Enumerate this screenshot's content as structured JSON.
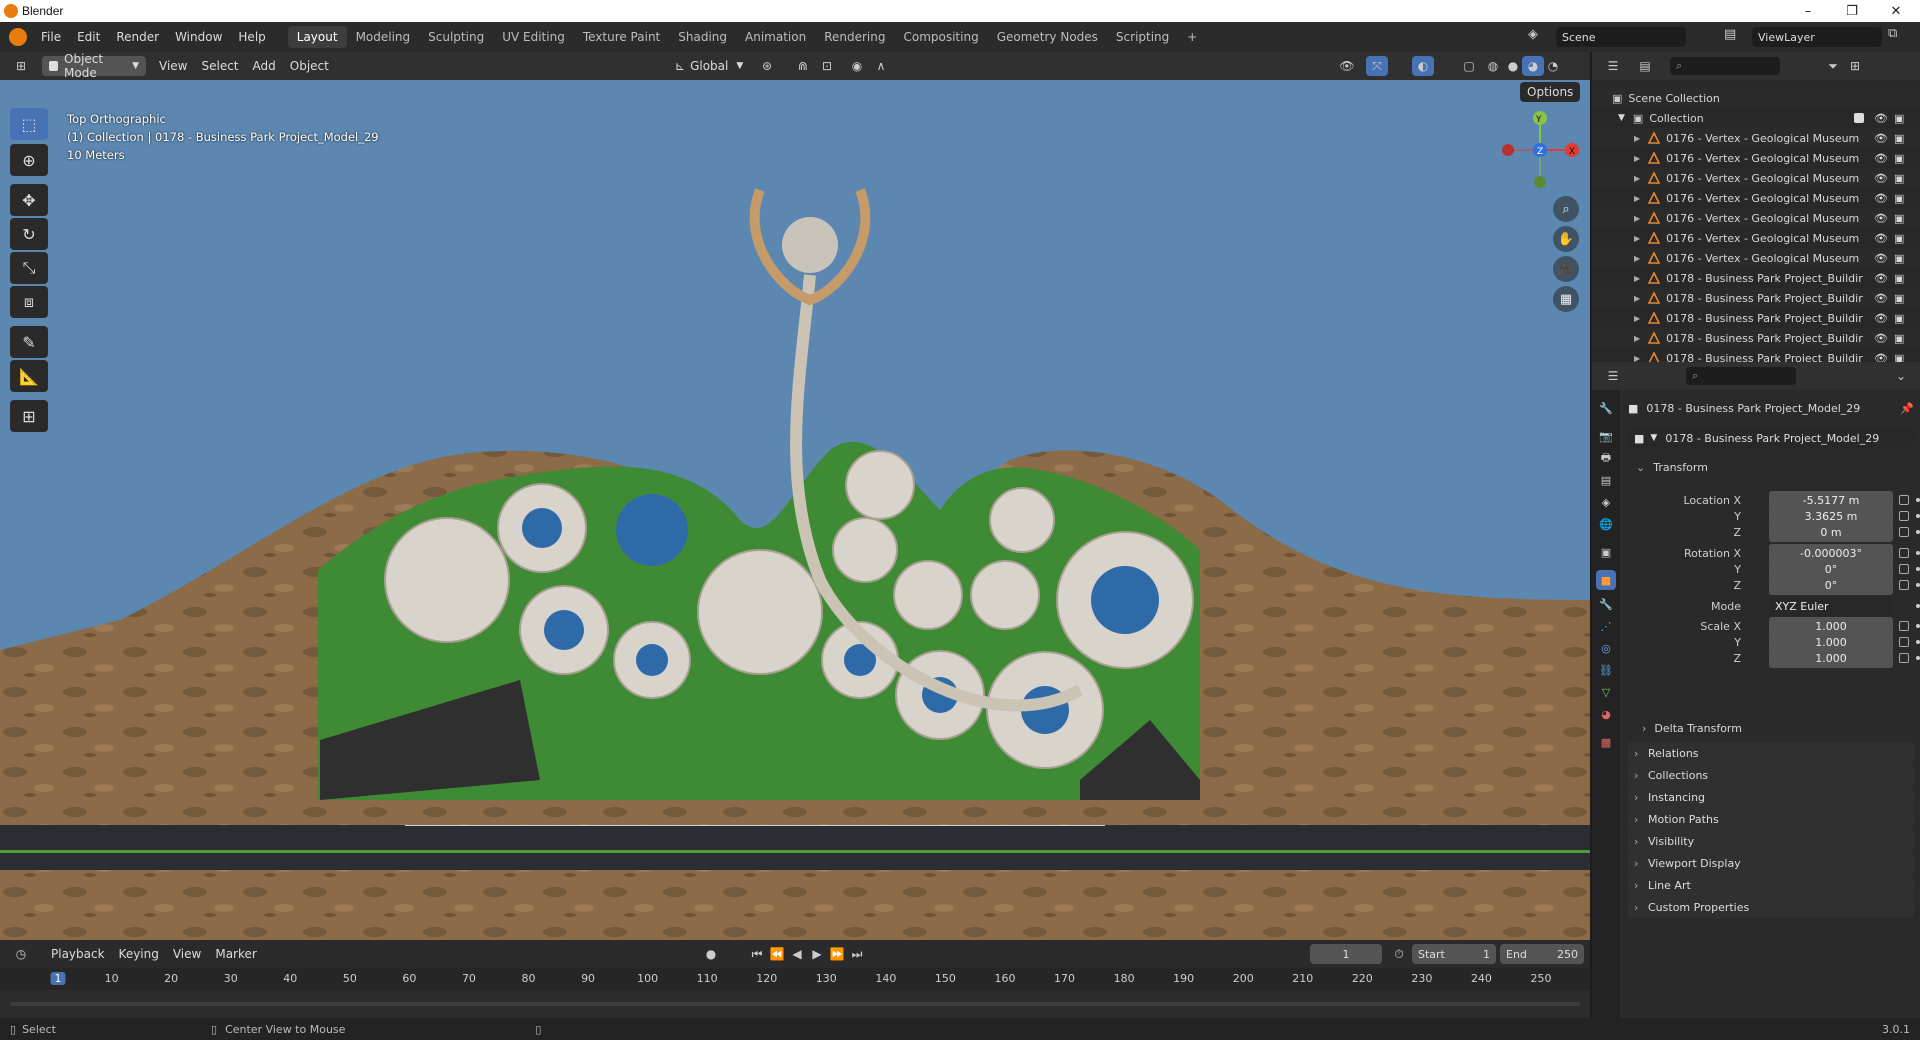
{
  "window": {
    "title": "Blender",
    "controls": [
      "–",
      "❐",
      "✕"
    ]
  },
  "menu": [
    "File",
    "Edit",
    "Render",
    "Window",
    "Help"
  ],
  "workspaces": [
    "Layout",
    "Modeling",
    "Sculpting",
    "UV Editing",
    "Texture Paint",
    "Shading",
    "Animation",
    "Rendering",
    "Compositing",
    "Geometry Nodes",
    "Scripting",
    "+"
  ],
  "active_workspace": "Layout",
  "scene": {
    "name": "Scene",
    "view_layer": "ViewLayer"
  },
  "viewport_header": {
    "mode": "Object Mode",
    "menus": [
      "View",
      "Select",
      "Add",
      "Object"
    ],
    "orientation": "Global",
    "options": "Options"
  },
  "viewport": {
    "view_name": "Top Orthographic",
    "collection_line": "(1) Collection | 0178 - Business Park Project_Model_29",
    "scale": "10 Meters",
    "gizmo": {
      "x": "X",
      "y": "Y",
      "z": "Z"
    }
  },
  "outliner": {
    "root": "Scene Collection",
    "collection": "Collection",
    "items": [
      "0176 - Vertex - Geological Museum",
      "0176 - Vertex - Geological Museum",
      "0176 - Vertex - Geological Museum",
      "0176 - Vertex - Geological Museum",
      "0176 - Vertex - Geological Museum",
      "0176 - Vertex - Geological Museum",
      "0176 - Vertex - Geological Museum",
      "0178 - Business Park Project_Buildir",
      "0178 - Business Park Project_Buildir",
      "0178 - Business Park Project_Buildir",
      "0178 - Business Park Project_Buildir",
      "0178 - Business Park Project_Buildir"
    ]
  },
  "properties": {
    "object_name": "0178 - Business Park Project_Model_29",
    "datablock": "0178 - Business Park Project_Model_29",
    "transform_label": "Transform",
    "rows": [
      {
        "label": "Location X",
        "value": "-5.5177 m"
      },
      {
        "label": "Y",
        "value": "3.3625 m"
      },
      {
        "label": "Z",
        "value": "0 m"
      },
      {
        "label": "Rotation X",
        "value": "-0.000003°"
      },
      {
        "label": "Y",
        "value": "0°"
      },
      {
        "label": "Z",
        "value": "0°"
      },
      {
        "label": "Mode",
        "value": "XYZ Euler"
      },
      {
        "label": "Scale X",
        "value": "1.000"
      },
      {
        "label": "Y",
        "value": "1.000"
      },
      {
        "label": "Z",
        "value": "1.000"
      }
    ],
    "delta": "Delta Transform",
    "panels": [
      "Relations",
      "Collections",
      "Instancing",
      "Motion Paths",
      "Visibility",
      "Viewport Display",
      "Line Art",
      "Custom Properties"
    ]
  },
  "timeline": {
    "menus": [
      "Playback",
      "Keying",
      "View",
      "Marker"
    ],
    "current_frame": "1",
    "start_label": "Start",
    "start": "1",
    "end_label": "End",
    "end": "250",
    "ticks": [
      "1",
      "10",
      "20",
      "30",
      "40",
      "50",
      "60",
      "70",
      "80",
      "90",
      "100",
      "110",
      "120",
      "130",
      "140",
      "150",
      "160",
      "170",
      "180",
      "190",
      "200",
      "210",
      "220",
      "230",
      "240",
      "250"
    ]
  },
  "status": {
    "select": "Select",
    "center": "Center View to Mouse",
    "version": "3.0.1"
  },
  "colors": {
    "accent": "#4772b3",
    "sky": "#5c87b0",
    "ground": "#8a6a47",
    "grass": "#3f8a35",
    "object_icon": "#e8892f"
  }
}
